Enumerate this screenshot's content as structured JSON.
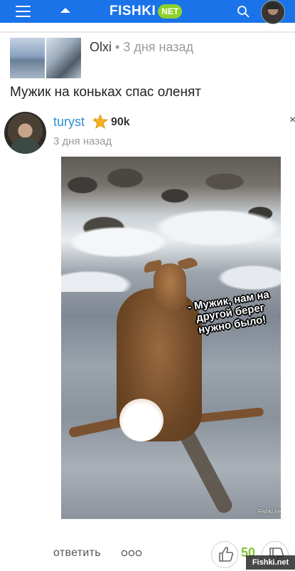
{
  "header": {
    "logo_text": "FISHKI",
    "logo_badge": "NET",
    "menu_icon": "hamburger-icon",
    "up_icon": "caret-up-icon",
    "search_icon": "search-icon",
    "accent_color": "#1a73e8",
    "badge_color": "#8ed12c"
  },
  "post": {
    "author": "Olxi",
    "separator": "•",
    "time": "3 дня назад",
    "title": "Мужик на коньках спас оленят"
  },
  "comment": {
    "author": "turyst",
    "rating": "90k",
    "time": "3 дня назад",
    "close": "×",
    "image_caption": "- Мужик, нам на другой берег нужно было!",
    "image_watermark": "Fishki.net",
    "reply_label": "ответить",
    "more_label": "ooo",
    "likes": "50"
  },
  "overlay": {
    "watermark": "Fishki.net"
  }
}
